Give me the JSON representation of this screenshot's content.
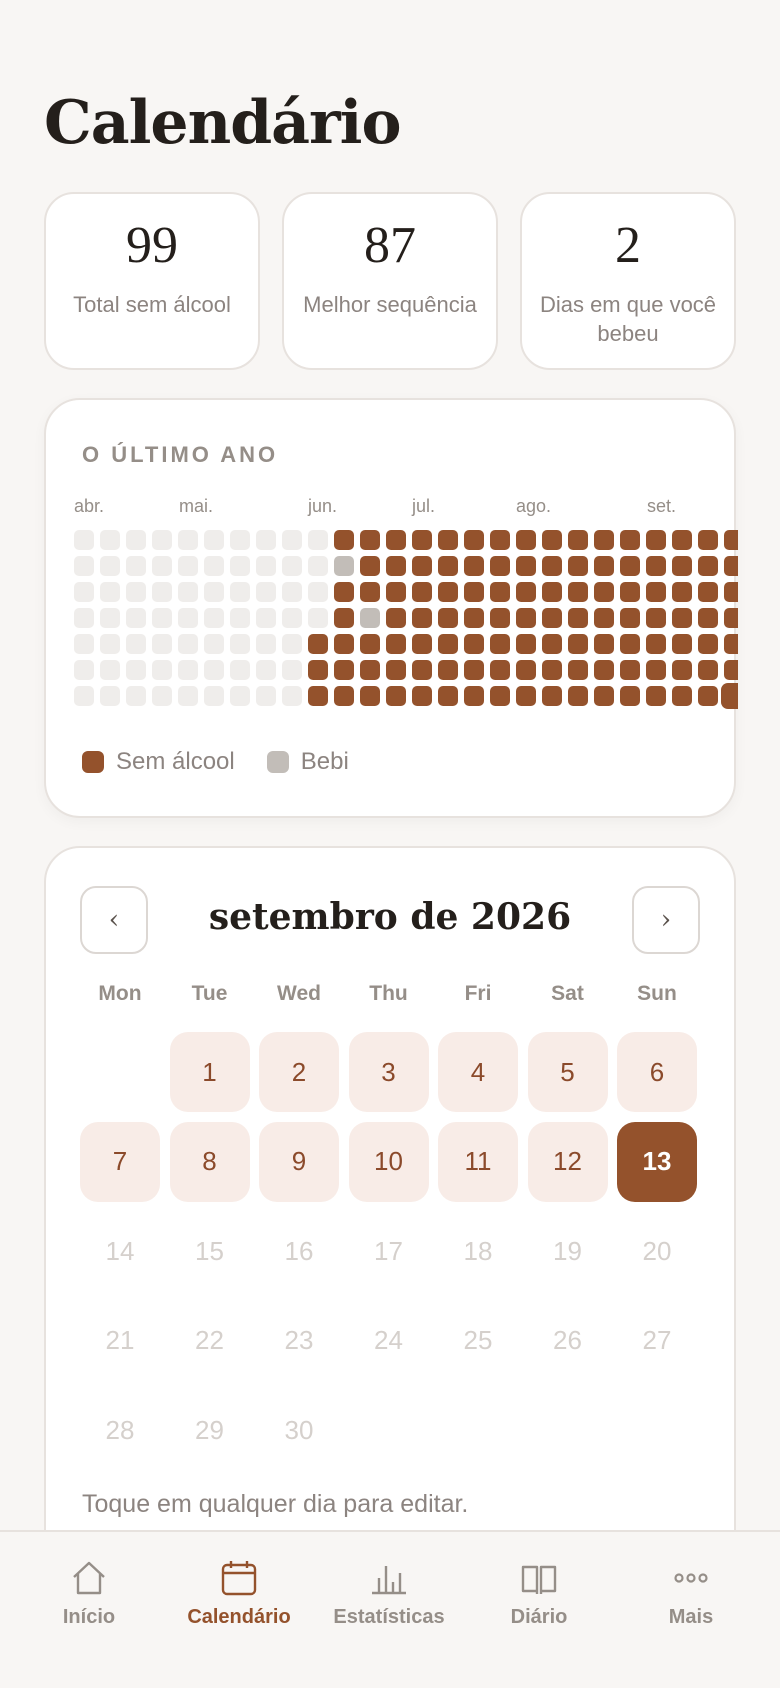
{
  "page": {
    "title": "Calendário"
  },
  "stats": [
    {
      "value": "99",
      "label": "Total sem álcool"
    },
    {
      "value": "87",
      "label": "Melhor sequência"
    },
    {
      "value": "2",
      "label": "Dias em que você bebeu"
    }
  ],
  "year": {
    "title": "O ÚLTIMO ANO",
    "months": [
      "abr.",
      "mai.",
      "jun.",
      "jul.",
      "ago.",
      "set."
    ],
    "colors": {
      "empty": "#efedeb",
      "sober": "#94522c",
      "drank": "#c2bdb8"
    },
    "grid": [
      "eeeeeeeeeessssssssssssssss",
      "eeeeeeeeeedsssssssssssssss",
      "eeeeeeeeeessssssssssssssss",
      "eeeeeeeeeesdssssssssssssss",
      "eeeeeeeeesssssssssssssssss",
      "eeeeeeeeesssssssssssssssss",
      "eeeeeeeeesssssssssssssssst"
    ],
    "legend": {
      "sober": "Sem álcool",
      "drank": "Bebi"
    }
  },
  "calendar": {
    "title": "setembro de 2026",
    "prev": "‹",
    "next": "›",
    "weekdays": [
      "Mon",
      "Tue",
      "Wed",
      "Thu",
      "Fri",
      "Sat",
      "Sun"
    ],
    "first_weekday_index": 1,
    "days_in_month": 30,
    "today": 13,
    "hint": "Toque em qualquer dia para editar."
  },
  "tabs": [
    {
      "label": "Início",
      "icon": "home-icon",
      "active": false
    },
    {
      "label": "Calendário",
      "icon": "calendar-icon",
      "active": true
    },
    {
      "label": "Estatísticas",
      "icon": "bar-chart-icon",
      "active": false
    },
    {
      "label": "Diário",
      "icon": "book-icon",
      "active": false
    },
    {
      "label": "Mais",
      "icon": "more-icon",
      "active": false
    }
  ]
}
